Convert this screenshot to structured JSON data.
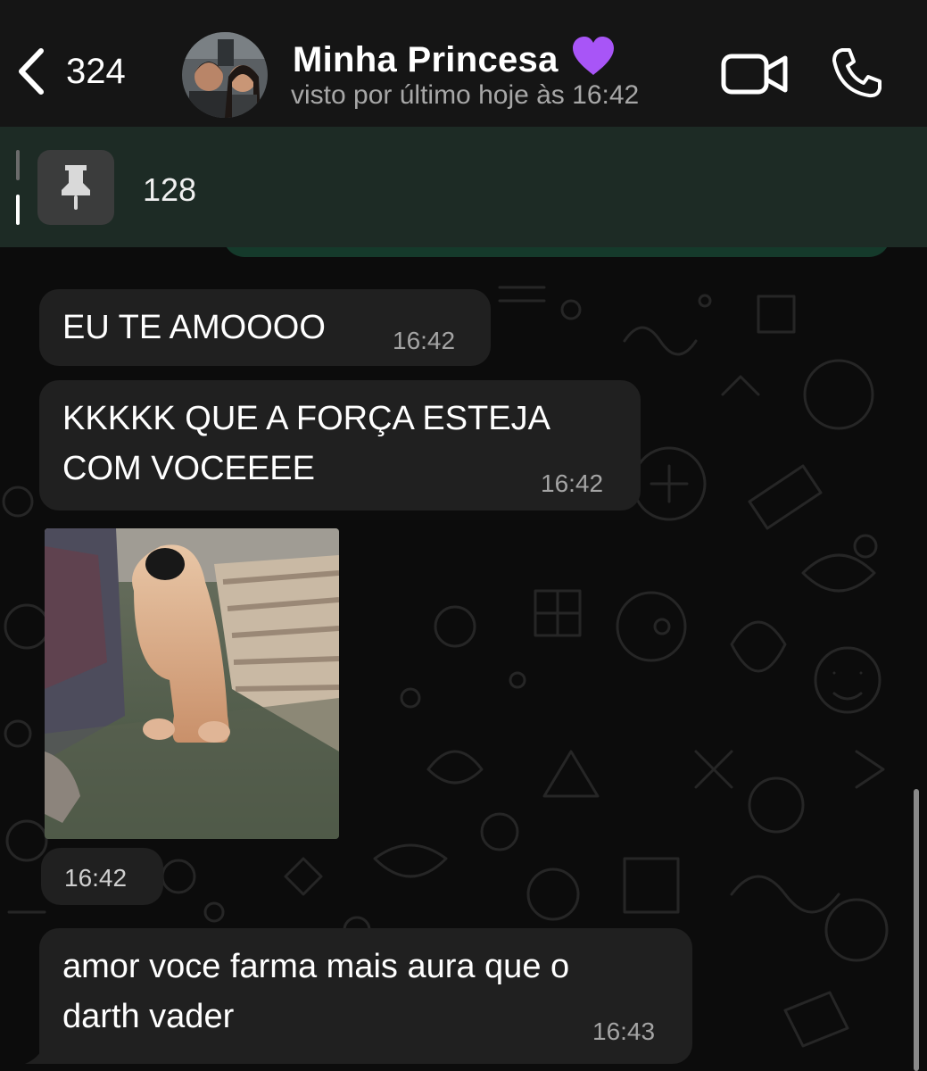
{
  "header": {
    "back_count": "324",
    "contact_name": "Minha Princesa",
    "contact_status": "visto por último hoje às 16:42",
    "heart_emoji": "purple-heart"
  },
  "pinned": {
    "text": "128",
    "icon": "pin-icon"
  },
  "messages": [
    {
      "type": "text",
      "lines": [
        "EU TE AMOOOO"
      ],
      "time": "16:42"
    },
    {
      "type": "text",
      "lines": [
        "KKKKK QUE A FORÇA ESTEJA",
        "COM VOCEEEE"
      ],
      "time": "16:42"
    },
    {
      "type": "image",
      "description": "gif",
      "time": "16:42"
    },
    {
      "type": "text",
      "lines": [
        "amor voce farma mais aura que o",
        "darth vader"
      ],
      "time": "16:43"
    }
  ],
  "colors": {
    "header_bg": "#151515",
    "bubble_bg": "#202020",
    "pin_bar_bg": "#1d2b25",
    "outgoing_bubble": "#153a2b",
    "heart": "#a855f7"
  }
}
